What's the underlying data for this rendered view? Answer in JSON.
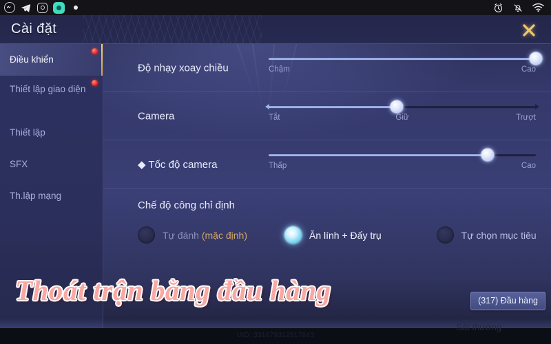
{
  "os_bar": {
    "apps": [
      {
        "name": "messenger-icon",
        "label": "Messenger"
      },
      {
        "name": "telegram-icon",
        "label": "Telegram"
      },
      {
        "name": "instagram-icon",
        "label": "Instagram"
      },
      {
        "name": "wechat-icon",
        "label": "WeChat"
      },
      {
        "name": "dot-indicator-icon",
        "label": ""
      }
    ],
    "system": [
      {
        "name": "alarm-clock-icon",
        "label": "Alarm"
      },
      {
        "name": "bell-muted-icon",
        "label": "Silent"
      },
      {
        "name": "wifi-icon",
        "label": "Wi-Fi"
      }
    ]
  },
  "panel": {
    "title": "Cài đặt",
    "close_label": "✕"
  },
  "sidebar": {
    "items": [
      {
        "label": "Điều khiển",
        "active": true,
        "badge": true
      },
      {
        "label": "Thiết lập giao diện",
        "active": false,
        "badge": true
      },
      {
        "label": "Thiết lập",
        "active": false,
        "badge": false
      },
      {
        "label": "SFX",
        "active": false,
        "badge": false
      },
      {
        "label": "Th.lập mạng",
        "active": false,
        "badge": false
      }
    ]
  },
  "settings": {
    "rows": [
      {
        "label": "Độ nhạy xoay chiều",
        "ticks": {
          "left": "Chậm",
          "right": "Cao"
        },
        "value_percent": 100
      },
      {
        "label": "Camera",
        "ticks": {
          "left": "Tắt",
          "center": "Giữ",
          "right": "Trượt"
        },
        "value_percent": 48
      },
      {
        "label": "◆ Tốc độ camera",
        "ticks": {
          "left": "Thấp",
          "right": "Cao"
        },
        "value_percent": 82
      }
    ],
    "mode_group": {
      "title": "Chế độ công chỉ định",
      "options": [
        {
          "label": "Tự đánh ",
          "accent": "(mặc định)",
          "selected": false
        },
        {
          "label": "Ăn lính + Đấy trụ",
          "accent": "",
          "selected": true
        },
        {
          "label": "Tự chọn mục tiêu",
          "accent": "",
          "selected": false
        }
      ]
    }
  },
  "overlay": {
    "banner_text": "Thoát trận bằng đầu hàng",
    "surrender_button": "(317) Đầu hàng"
  },
  "game_hud": {
    "uid": "UID: 331679312517643",
    "damage_label": "Sát thương"
  },
  "colors": {
    "accent_gold": "#f3d27a",
    "panel_bg": "#2d3160",
    "slider_fill": "#9fb2ee",
    "selected_radio": "#7ed8f2",
    "badge_red": "#e01d1d",
    "banner_pink": "#f9a8a3"
  }
}
